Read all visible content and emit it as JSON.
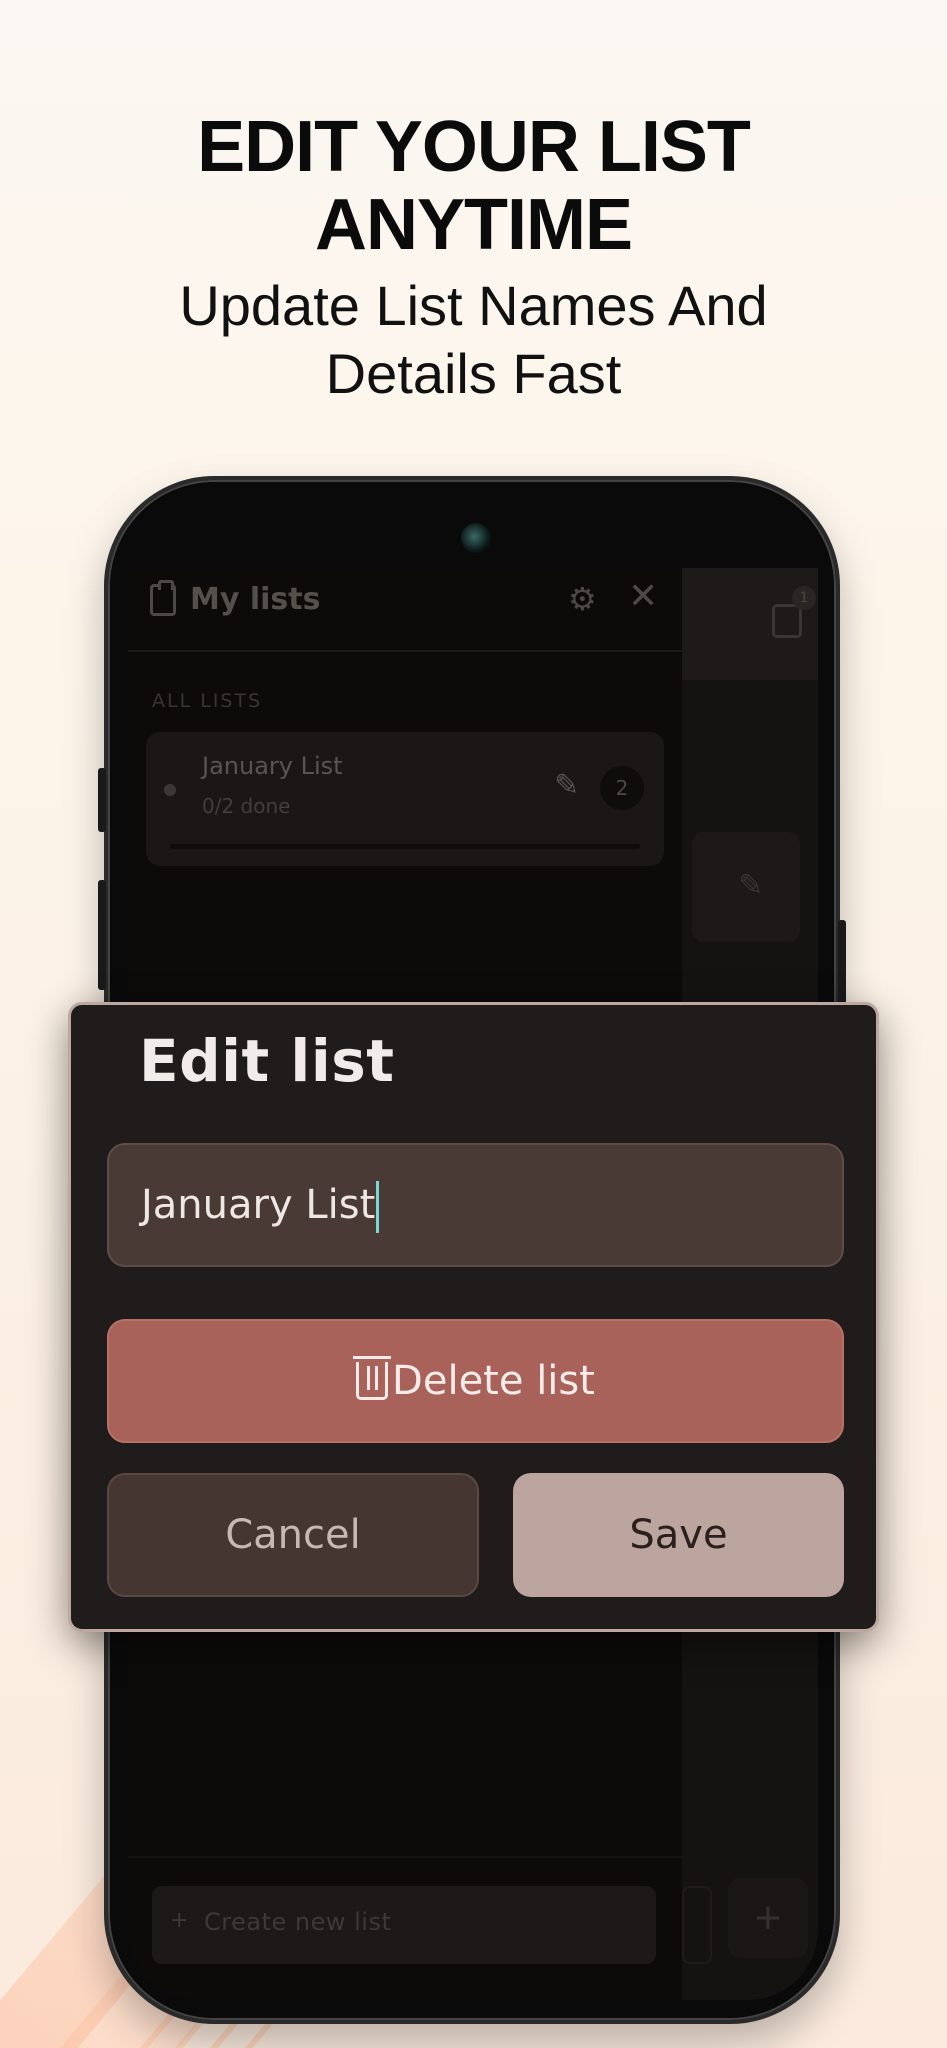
{
  "header": {
    "title_line1": "EDIT YOUR LIST",
    "title_line2": "ANYTIME",
    "subtitle_line1": "Update List Names And",
    "subtitle_line2": "Details Fast"
  },
  "drawer": {
    "title": "My lists",
    "section_label": "ALL LISTS",
    "lists": [
      {
        "name": "January List",
        "progress": "0/2 done",
        "count": "2"
      }
    ],
    "create_button": "Create new list"
  },
  "background_badge": "1",
  "dialog": {
    "title": "Edit list",
    "input_value": "January List",
    "delete_label": "Delete list",
    "cancel_label": "Cancel",
    "save_label": "Save"
  },
  "colors": {
    "delete": "#a8625a",
    "save": "#bca59e",
    "cancel": "#463632",
    "input": "#4a3a36",
    "dialog_bg": "#201c1b",
    "caret": "#7ad9d2"
  },
  "icons": [
    "clipboard-icon",
    "gear-icon",
    "close-icon",
    "pencil-icon",
    "trash-icon",
    "calendar-icon",
    "plus-icon"
  ]
}
